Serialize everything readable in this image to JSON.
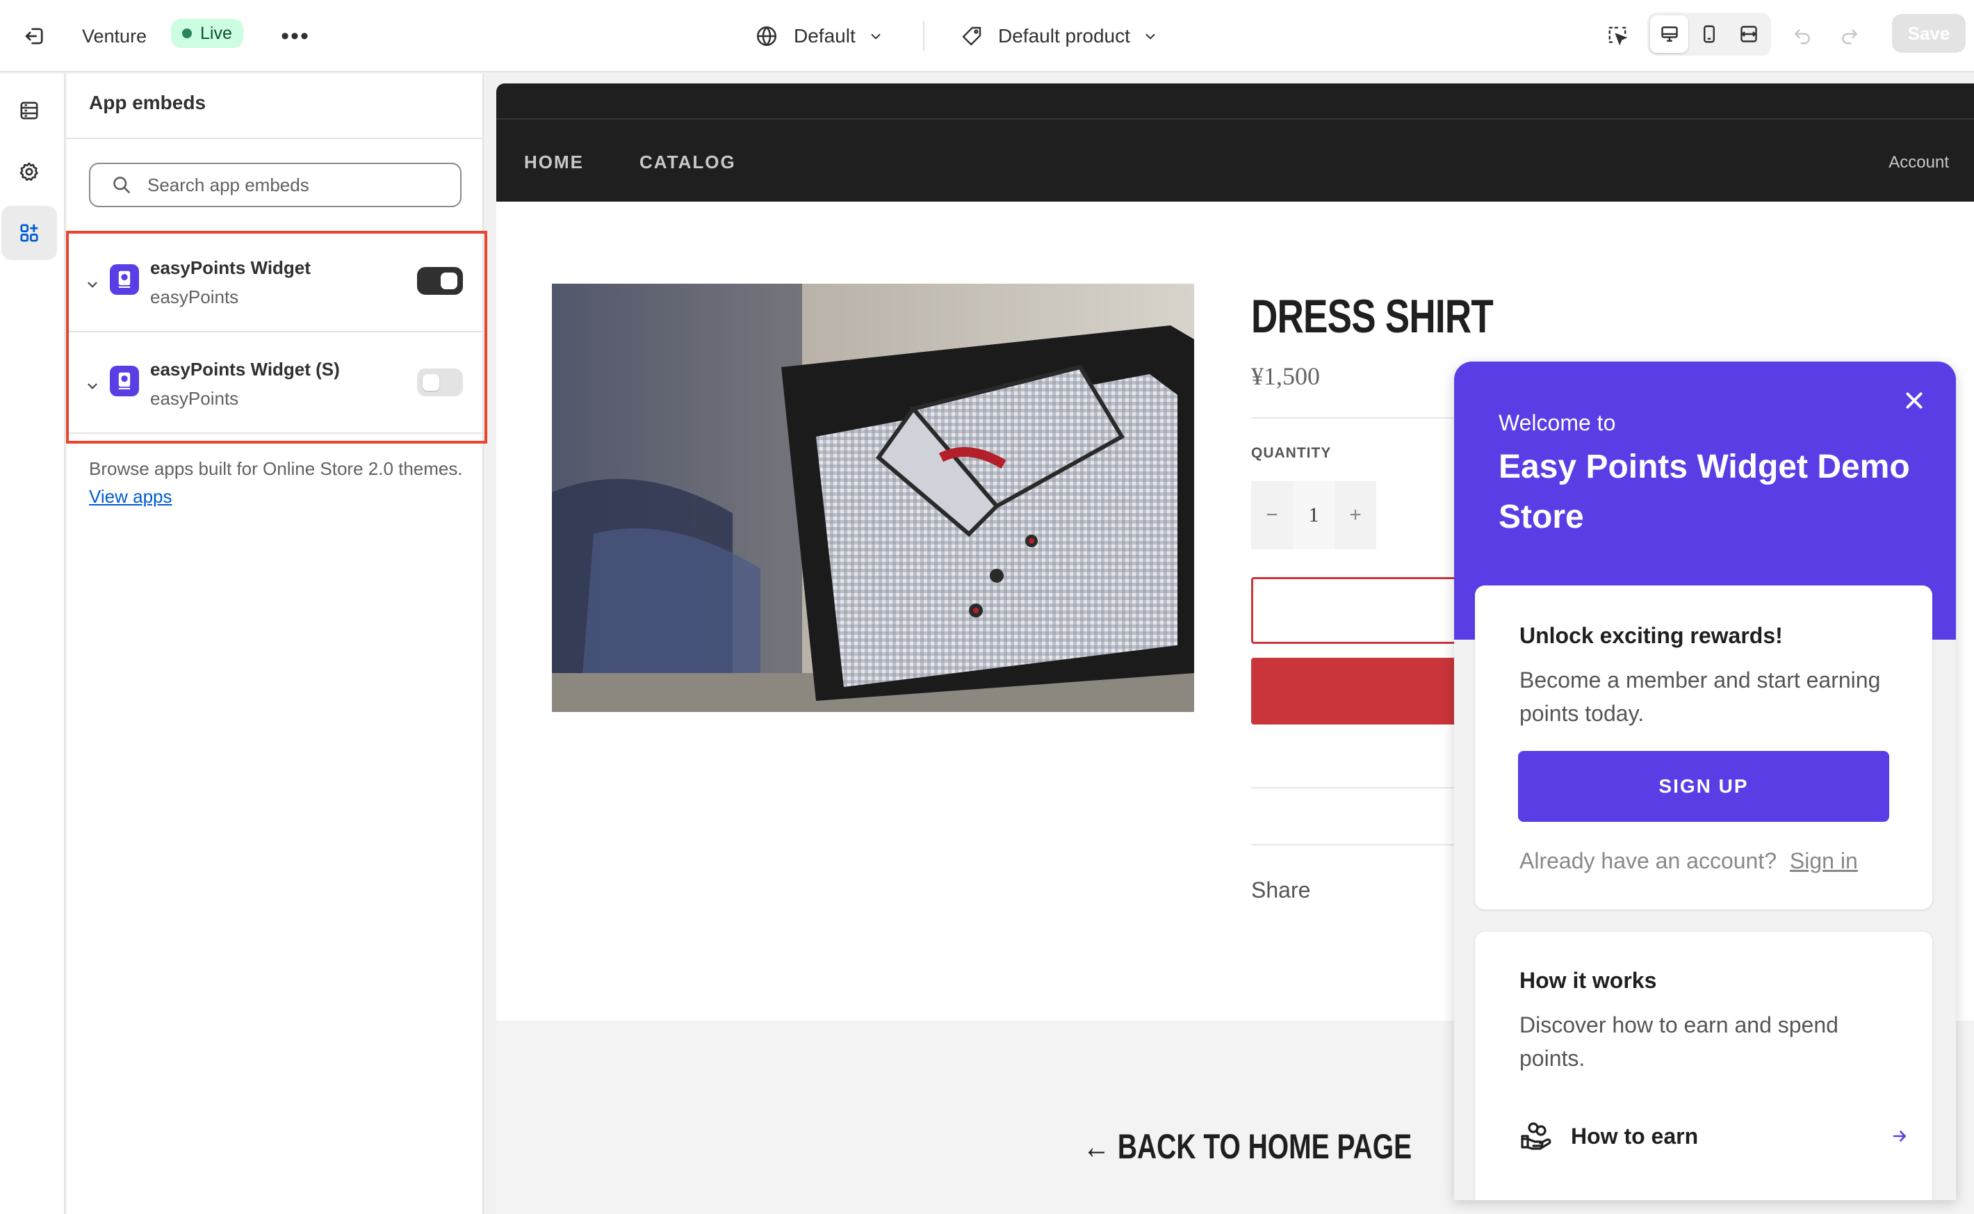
{
  "topbar": {
    "store_name": "Venture",
    "status": "Live",
    "more": "•••",
    "theme": "Default",
    "template": "Default product",
    "save_label": "Save"
  },
  "sidebar": {
    "active_item": "app-embeds",
    "items": [
      "sections-icon",
      "settings-icon",
      "app-embeds-icon"
    ]
  },
  "panel": {
    "title": "App embeds",
    "search_placeholder": "Search app embeds",
    "embeds": [
      {
        "name": "easyPoints Widget",
        "provider": "easyPoints",
        "enabled": true
      },
      {
        "name": "easyPoints Widget (S)",
        "provider": "easyPoints",
        "enabled": false
      }
    ],
    "browse_text": "Browse apps built for Online Store 2.0 themes.",
    "browse_link": "View apps"
  },
  "store": {
    "nav": [
      "HOME",
      "CATALOG"
    ],
    "account": "Account",
    "product_title": "DRESS SHIRT",
    "price": "¥1,500",
    "quantity_label": "QUANTITY",
    "quantity": "1",
    "qty_minus": "−",
    "qty_plus": "+",
    "share": "Share",
    "back_link": "← BACK TO HOME PAGE"
  },
  "widget": {
    "welcome": "Welcome to",
    "store_name": "Easy Points Widget Demo Store",
    "card1_title": "Unlock exciting rewards!",
    "card1_text": "Become a member and start earning points today.",
    "signup": "SIGN UP",
    "signin_prompt": "Already have an account?",
    "signin_link": "Sign in",
    "card2_title": "How it works",
    "card2_text": "Discover how to earn and spend points.",
    "earn_label": "How to earn"
  },
  "colors": {
    "accent": "#5b3de6",
    "highlight": "#e8452c",
    "cart_red": "#c9353a",
    "live_bg": "#cdfee1"
  }
}
